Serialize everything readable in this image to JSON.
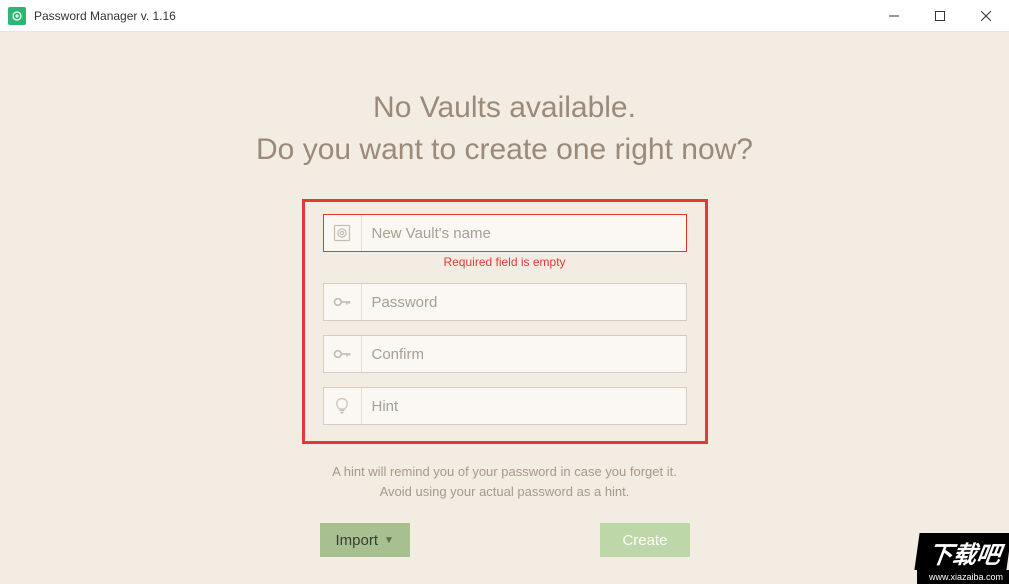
{
  "window": {
    "title": "Password Manager v. 1.16"
  },
  "heading": {
    "line1": "No Vaults available.",
    "line2": "Do you want to create one right now?"
  },
  "form": {
    "vault_name": {
      "placeholder": "New Vault's name",
      "value": "",
      "error": "Required field is empty"
    },
    "password": {
      "placeholder": "Password",
      "value": ""
    },
    "confirm": {
      "placeholder": "Confirm",
      "value": ""
    },
    "hint": {
      "placeholder": "Hint",
      "value": ""
    }
  },
  "hint_text": {
    "line1": "A hint will remind you of your password in case you forget it.",
    "line2": "Avoid using your actual password as a hint."
  },
  "buttons": {
    "import": "Import",
    "create": "Create"
  },
  "watermark": {
    "main": "下载吧",
    "sub": "www.xiazaiba.com"
  }
}
